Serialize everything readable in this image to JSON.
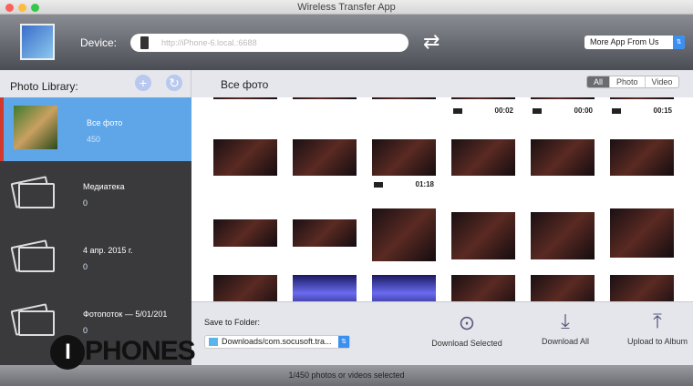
{
  "window": {
    "title": "Wireless Transfer App"
  },
  "toolbar": {
    "device_label": "Device:",
    "device_url": "http://iPhone-6.local.:6688",
    "more_apps": "More App From Us"
  },
  "sidebar": {
    "title": "Photo Library:",
    "albums": [
      {
        "name": "Все фото",
        "count": "450"
      },
      {
        "name": "Медиатека",
        "count": "0"
      },
      {
        "name": "4 апр. 2015 г.",
        "count": "0"
      },
      {
        "name": "Фотопоток — 5/01/201",
        "count": "0"
      }
    ]
  },
  "main": {
    "title": "Все фото",
    "filters": [
      "All",
      "Photo",
      "Video"
    ],
    "video_durations": [
      "00:02",
      "00:00",
      "00:15",
      "01:18"
    ]
  },
  "bottom": {
    "save_label": "Save to Folder:",
    "folder": "Downloads/com.socusoft.tra...",
    "download_selected": "Download Selected",
    "download_all": "Download All",
    "upload": "Upload to Album"
  },
  "status": "1/450 photos or videos selected",
  "watermark": "IPHONES",
  "colors": {
    "accent": "#5fa6e8",
    "selected_marker": "#d0392b"
  }
}
